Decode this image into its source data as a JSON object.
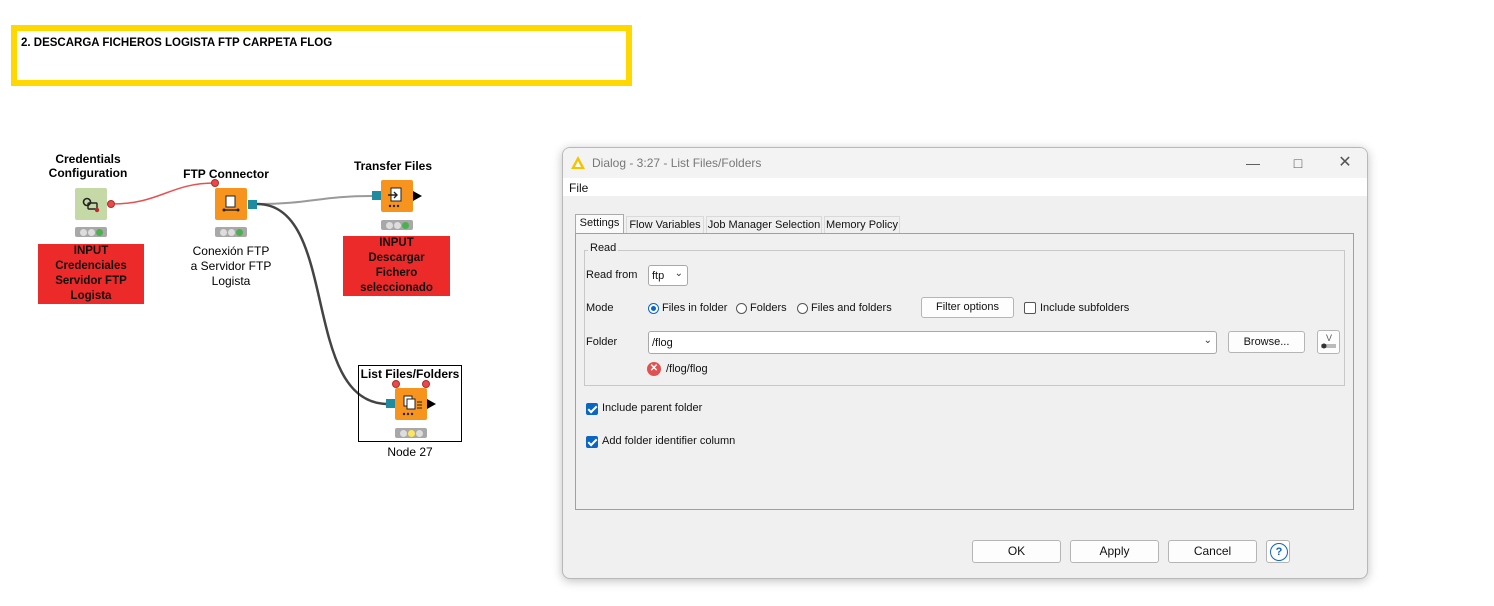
{
  "annotation": {
    "text": "2. DESCARGA FICHEROS LOGISTA FTP CARPETA FLOG"
  },
  "workflow": {
    "nodes": [
      {
        "id": "credentials",
        "title_line1": "Credentials",
        "title_line2": "Configuration",
        "label_lines": [
          "INPUT",
          "Credenciales",
          "Servidor FTP",
          "Logista"
        ],
        "icon": "credentials-icon"
      },
      {
        "id": "ftp",
        "title": "FTP Connector",
        "label_lines": [
          "Conexión FTP",
          "a Servidor FTP",
          "Logista"
        ],
        "icon": "ftp-connector-icon"
      },
      {
        "id": "transfer",
        "title": "Transfer Files",
        "label_lines": [
          "INPUT",
          "Descargar",
          "Fichero",
          "seleccionado"
        ],
        "icon": "transfer-files-icon"
      },
      {
        "id": "list",
        "title": "List Files/Folders",
        "label": "Node 27",
        "icon": "list-files-icon"
      }
    ]
  },
  "dialog": {
    "title": "Dialog - 3:27 - List Files/Folders",
    "menu": [
      "File"
    ],
    "tabs": [
      "Settings",
      "Flow Variables",
      "Job Manager Selection",
      "Memory Policy"
    ],
    "read_section": "Read",
    "read_from_label": "Read from",
    "read_from_value": "ftp",
    "mode_label": "Mode",
    "mode_options": [
      "Files in folder",
      "Folders",
      "Files and folders"
    ],
    "mode_selected": "Files in folder",
    "filter_options_button": "Filter options",
    "include_subfolders": {
      "label": "Include subfolders",
      "checked": false
    },
    "folder_label": "Folder",
    "folder_value": "/flog",
    "browse_button": "Browse...",
    "error_path": "/flog/flog",
    "include_parent_folder": {
      "label": "Include parent folder",
      "checked": true
    },
    "add_folder_identifier": {
      "label": "Add folder identifier column",
      "checked": true
    },
    "buttons": {
      "ok": "OK",
      "apply": "Apply",
      "cancel": "Cancel",
      "help": "?"
    }
  },
  "colors": {
    "annotation_border": "#ffd800",
    "node_label_red": "#ec2a2a",
    "node_orange": "#f7941d",
    "accent": "#0b66c3"
  }
}
